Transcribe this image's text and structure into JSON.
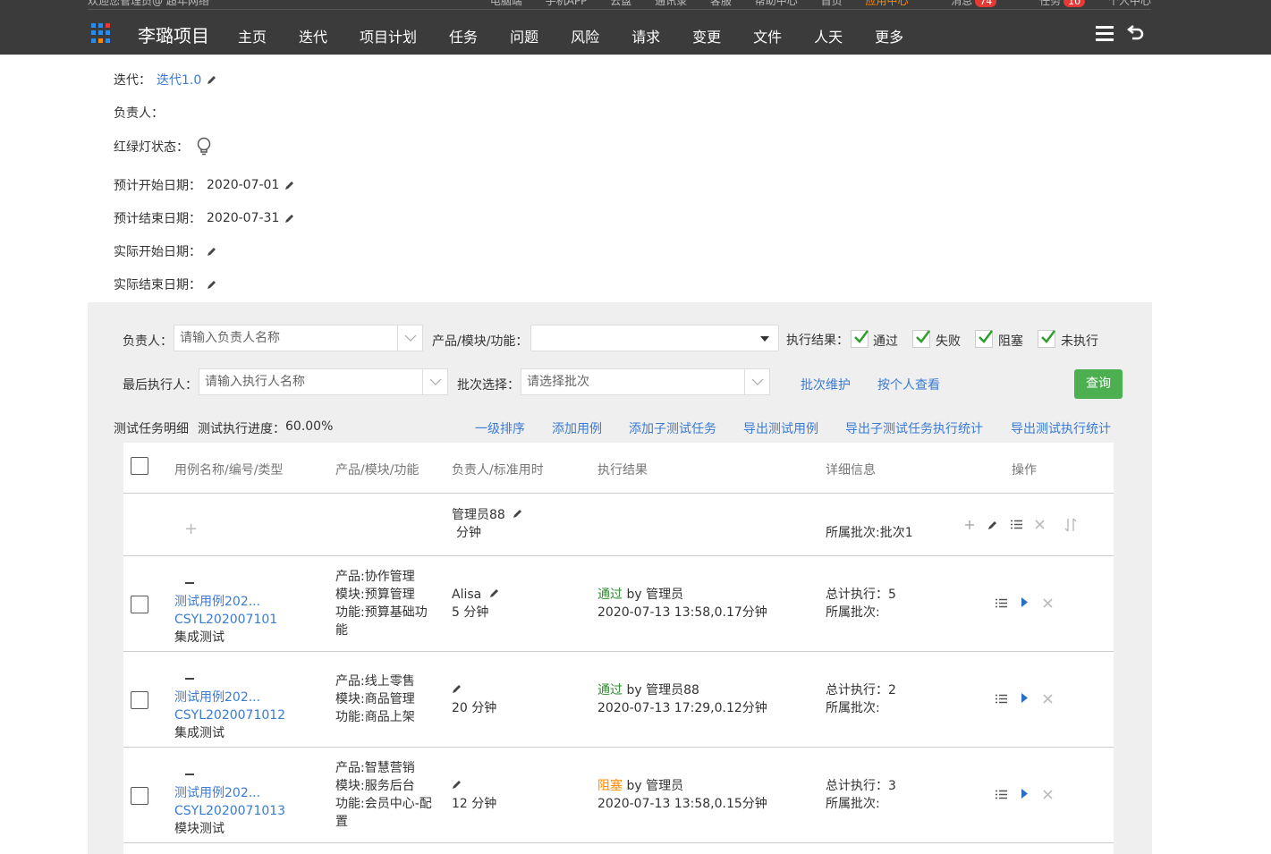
{
  "topbar": {
    "welcome": "欢迎您管理员@ 超年网络",
    "links": [
      {
        "label": "电脑端"
      },
      {
        "label": "手机APP"
      },
      {
        "label": "云盘"
      },
      {
        "label": "通讯录"
      },
      {
        "label": "客服"
      },
      {
        "label": "帮助中心"
      },
      {
        "label": "首页"
      },
      {
        "label": "应用中心"
      },
      {
        "label": "消息",
        "badge": "74"
      },
      {
        "label": "任务",
        "badge": "10"
      },
      {
        "label": "个人中心"
      }
    ],
    "project_title": "李璐项目",
    "nav": [
      "主页",
      "迭代",
      "项目计划",
      "任务",
      "问题",
      "风险",
      "请求",
      "变更",
      "文件",
      "人天",
      "更多"
    ],
    "grid_colors": [
      "#2b8be6",
      "#2b8be6",
      "#e53935",
      "#2b8be6",
      "#2b8be6",
      "#2b8be6",
      "#2b8be6",
      "#ff8a00",
      "#2b8be6"
    ]
  },
  "info": {
    "iteration_label": "迭代：",
    "iteration_value": "迭代1.0",
    "owner_label": "负责人：",
    "light_label": "红绿灯状态：",
    "plan_start_label": "预计开始日期：",
    "plan_start_value": "2020-07-01",
    "plan_end_label": "预计结束日期：",
    "plan_end_value": "2020-07-31",
    "actual_start_label": "实际开始日期：",
    "actual_end_label": "实际结束日期："
  },
  "filters": {
    "owner_label": "负责人：",
    "owner_placeholder": "请输入负责人名称",
    "product_label": "产品/模块/功能：",
    "result_label": "执行结果：",
    "results": [
      "通过",
      "失败",
      "阻塞",
      "未执行"
    ],
    "executor_label": "最后执行人：",
    "executor_placeholder": "请输入执行人名称",
    "batch_label": "批次选择：",
    "batch_placeholder": "请选择批次",
    "batch_maintain": "批次维护",
    "by_person": "按个人查看",
    "query": "查询"
  },
  "detail": {
    "title": "测试任务明细",
    "progress_label": "测试执行进度：",
    "progress_value": "60.00%",
    "actions": [
      "一级排序",
      "添加用例",
      "添加子测试任务",
      "导出测试用例",
      "导出子测试任务执行统计",
      "导出测试执行统计"
    ]
  },
  "table": {
    "headers": [
      "用例名称/编号/类型",
      "产品/模块/功能",
      "负责人/标准用时",
      "执行结果",
      "详细信息",
      "操作"
    ],
    "batch_row": {
      "owner": "管理员88",
      "time": "分钟",
      "batch": "所属批次:批次1"
    },
    "rows": [
      {
        "name": "测试用例202...",
        "code": "CSYL202007101",
        "type": "集成测试",
        "product": "产品:协作管理",
        "module": "模块:预算管理",
        "function": "功能:预算基础功能",
        "owner": "Alisa",
        "time": "5 分钟",
        "status": "通过",
        "by": "by 管理员",
        "exec_info": "2020-07-13 13:58,0.17分钟",
        "total": "总计执行：5",
        "batch": "所属批次:"
      },
      {
        "name": "测试用例202...",
        "code": "CSYL2020071012",
        "type": "集成测试",
        "product": "产品:线上零售",
        "module": "模块:商品管理",
        "function": "功能:商品上架",
        "owner": "",
        "time": "20 分钟",
        "status": "通过",
        "by": "by 管理员88",
        "exec_info": "2020-07-13 17:29,0.12分钟",
        "total": "总计执行：2",
        "batch": "所属批次:"
      },
      {
        "name": "测试用例202...",
        "code": "CSYL2020071013",
        "type": "模块测试",
        "product": "产品:智慧营销",
        "module": "模块:服务后台",
        "function": "功能:会员中心-配置",
        "owner": "",
        "time": "12 分钟",
        "status": "阻塞",
        "by": "by 管理员",
        "exec_info": "2020-07-13 13:58,0.15分钟",
        "total": "总计执行：3",
        "batch": "所属批次:"
      }
    ]
  }
}
